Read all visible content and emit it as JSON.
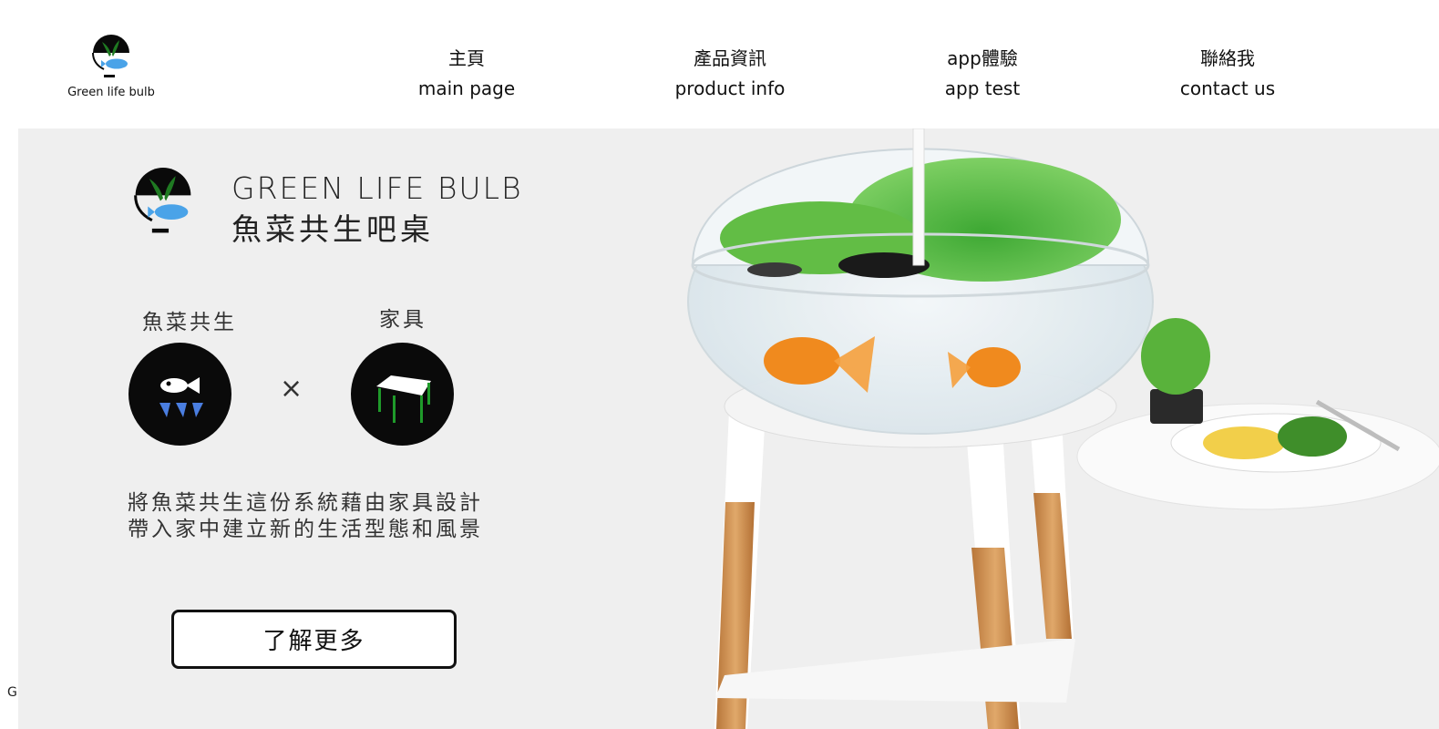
{
  "brand": {
    "name": "Green life bulb",
    "logo_icon": "fish-plant-bulb-logo-icon"
  },
  "nav": {
    "items": [
      {
        "zh": "主頁",
        "en": "main page"
      },
      {
        "zh": "產品資訊",
        "en": "product info"
      },
      {
        "zh": "app體驗",
        "en": "app test"
      },
      {
        "zh": "聯絡我",
        "en": "contact us"
      }
    ]
  },
  "hero": {
    "title_en": "GREEN LIFE BULB",
    "title_zh": "魚菜共生吧桌",
    "concept_left_label": "魚菜共生",
    "concept_right_label": "家具",
    "concept_left_icon": "fish-plant-icon",
    "concept_right_icon": "table-icon",
    "times_symbol": "×",
    "description_line1": "將魚菜共生這份系統藉由家具設計",
    "description_line2": "帶入家中建立新的生活型態和風景",
    "cta_label": "了解更多",
    "product_image": "aquaponics-table-image"
  },
  "side_char": "G",
  "colors": {
    "hero_bg": "#efefef",
    "logo_green": "#1f7a22",
    "logo_blue": "#4aa3e8",
    "icon_black": "#0a0a0a"
  }
}
